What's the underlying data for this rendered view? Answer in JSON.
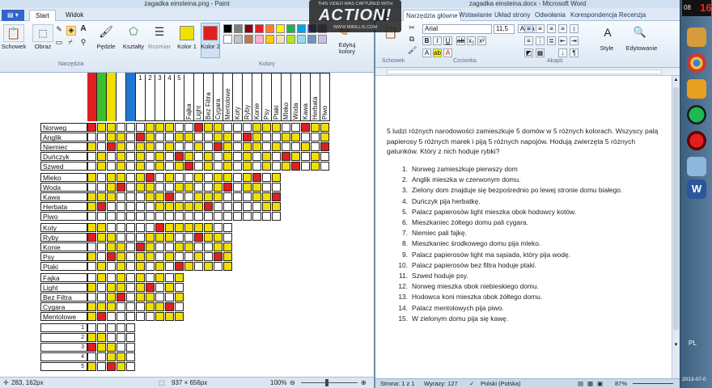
{
  "paint": {
    "title": "zagadka einsteina.png - Paint",
    "tabs": [
      "Start",
      "Widok"
    ],
    "groups": {
      "clipboard": "Schowek",
      "image": "Obraz",
      "tools": "Narzędzia",
      "brushes": "Pędzle",
      "shapes": "Kształty",
      "size": "Rozmiar",
      "color1": "Kolor 1",
      "color2": "Kolor 2",
      "colors": "Kolory",
      "edit_colors": "Edytuj kolory"
    },
    "color1": "#f0e000",
    "color2": "#e02020",
    "palette": [
      "#000000",
      "#7f7f7f",
      "#880015",
      "#ed1c24",
      "#ff7f27",
      "#fff200",
      "#22b14c",
      "#00a2e8",
      "#3f48cc",
      "#a349a4",
      "#ffffff",
      "#c3c3c3",
      "#b97a57",
      "#ffaec9",
      "#ffc90e",
      "#efe4b0",
      "#b5e61d",
      "#99d9ea",
      "#7092be",
      "#c8bfe7"
    ],
    "status": {
      "cursor": "283, 162px",
      "canvas_size": "937 × 656px",
      "zoom": "100%"
    }
  },
  "grid": {
    "color_headers": [
      "#e02020",
      "#3cbf2c",
      "#f0e000",
      "#ffffff",
      "#1e78d2"
    ],
    "number_headers": [
      "1",
      "2",
      "3",
      "4",
      "5"
    ],
    "cigar_headers": [
      "Fajka",
      "Light",
      "Bez Filtra",
      "Cygara",
      "Mentolowe"
    ],
    "animal_headers": [
      "Koty",
      "Ryby",
      "Konie",
      "Psy",
      "Ptaki"
    ],
    "drink_headers": [
      "Mleko",
      "Woda",
      "Kawa",
      "Herbata",
      "Piwo"
    ],
    "nations": [
      "Norweg",
      "Anglik",
      "Niemiec",
      "Duńczyk",
      "Szwed"
    ],
    "drinks": [
      "Mleko",
      "Woda",
      "Kawa",
      "Herbata",
      "Piwo"
    ],
    "animals": [
      "Koty",
      "Ryby",
      "Konie",
      "Psy",
      "Ptaki"
    ],
    "cigars": [
      "Fajka",
      "Light",
      "Bez Filtra",
      "Cygara",
      "Mentolowe"
    ],
    "numbers": [
      "1",
      "2",
      "3",
      "4",
      "5"
    ]
  },
  "word": {
    "title": "zagadka einsteina.docx - Microsoft Word",
    "tabs": [
      "Narzędzia główne",
      "Wstawianie",
      "Układ strony",
      "Odwołania",
      "Korespondencja",
      "Recenzja"
    ],
    "font_name": "Arial",
    "font_size": "11,5",
    "groups": {
      "clipboard": "Schowek",
      "font": "Czcionka",
      "paragraph": "Akapit",
      "styles": "Style",
      "editing": "Edytowanie"
    },
    "intro": "5 ludzi różnych narodowości zamieszkuje  5 domów w 5 różnych kolorach. Wszyscy palą papierosy 5 różnych marek i piją 5 różnych napojów. Hodują zwierzęta  5 różnych gatunków. Który z nich hoduje rybki?",
    "clues": [
      "Norweg zamieszkuje  pierwszy  dom",
      "Anglik mieszka w czerwonym domu.",
      "Zielony dom znajduje  się bezpośrednio po lewej stronie domu białego.",
      "Duńczyk pija herbatkę.",
      "Palacz papierosów light mieszka obok hodowcy kotów.",
      "Mieszkaniec żółtego domu pali cygara.",
      "Niemiec pali fajkę.",
      "Mieszkaniec  środkowego domu pija mleko.",
      "Palacz papierosów light ma sąsiada, który pija wodę.",
      "Palacz papierosów bez filtra hoduje ptaki.",
      "Szwed hoduje psy.",
      "Norweg mieszka obok niebieskiego domu.",
      "Hodowca koni mieszka obok żółtego domu.",
      "Palacz mentolowych pija piwo.",
      "W zielonym domu pija się kawę."
    ],
    "status": {
      "page": "Strona: 1 z 1",
      "words": "Wyrazy: 127",
      "lang": "Polski (Polska)",
      "zoom": "87%"
    }
  },
  "overlay": {
    "line1": "THIS VIDEO WAS CAPTURED WITH",
    "logo": "ACTION!",
    "line2": "WWW.MIRILLIS.COM"
  },
  "taskbar": {
    "clock": "08",
    "clock2": "16",
    "date": "2013-07-0",
    "lang": "PL"
  }
}
